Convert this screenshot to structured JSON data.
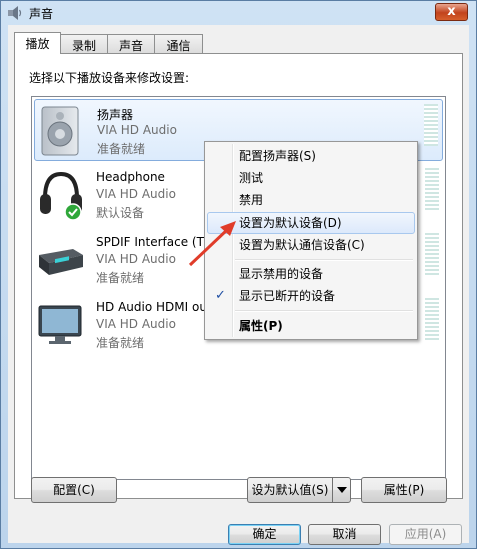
{
  "window": {
    "title": "声音",
    "close_label": "x"
  },
  "tabs": [
    {
      "label": "播放"
    },
    {
      "label": "录制"
    },
    {
      "label": "声音"
    },
    {
      "label": "通信"
    }
  ],
  "panel": {
    "instruction": "选择以下播放设备来修改设置:"
  },
  "devices": [
    {
      "name": "扬声器",
      "driver": "VIA HD Audio",
      "status": "准备就绪",
      "icon": "speaker-icon"
    },
    {
      "name": "Headphone",
      "driver": "VIA HD Audio",
      "status": "默认设备",
      "icon": "headphone-icon"
    },
    {
      "name": "SPDIF Interface (TX",
      "driver": "VIA HD Audio",
      "status": "准备就绪",
      "icon": "spdif-icon"
    },
    {
      "name": "HD Audio HDMI ou",
      "driver": "VIA HD Audio",
      "status": "准备就绪",
      "icon": "monitor-icon"
    }
  ],
  "context_menu": {
    "items": [
      {
        "label": "配置扬声器(S)"
      },
      {
        "label": "测试"
      },
      {
        "label": "禁用"
      },
      {
        "label": "设置为默认设备(D)"
      },
      {
        "label": "设置为默认通信设备(C)"
      },
      {
        "label": "显示禁用的设备"
      },
      {
        "label": "显示已断开的设备"
      },
      {
        "label": "属性(P)"
      }
    ],
    "check_mark": "✓"
  },
  "buttons": {
    "configure": "配置(C)",
    "set_default": "设为默认值(S)",
    "properties": "属性(P)",
    "ok": "确定",
    "cancel": "取消",
    "apply": "应用(A)"
  },
  "colors": {
    "selection_border": "#84acdd",
    "arrow": "#e03c2a",
    "check": "#1f4fa3"
  }
}
